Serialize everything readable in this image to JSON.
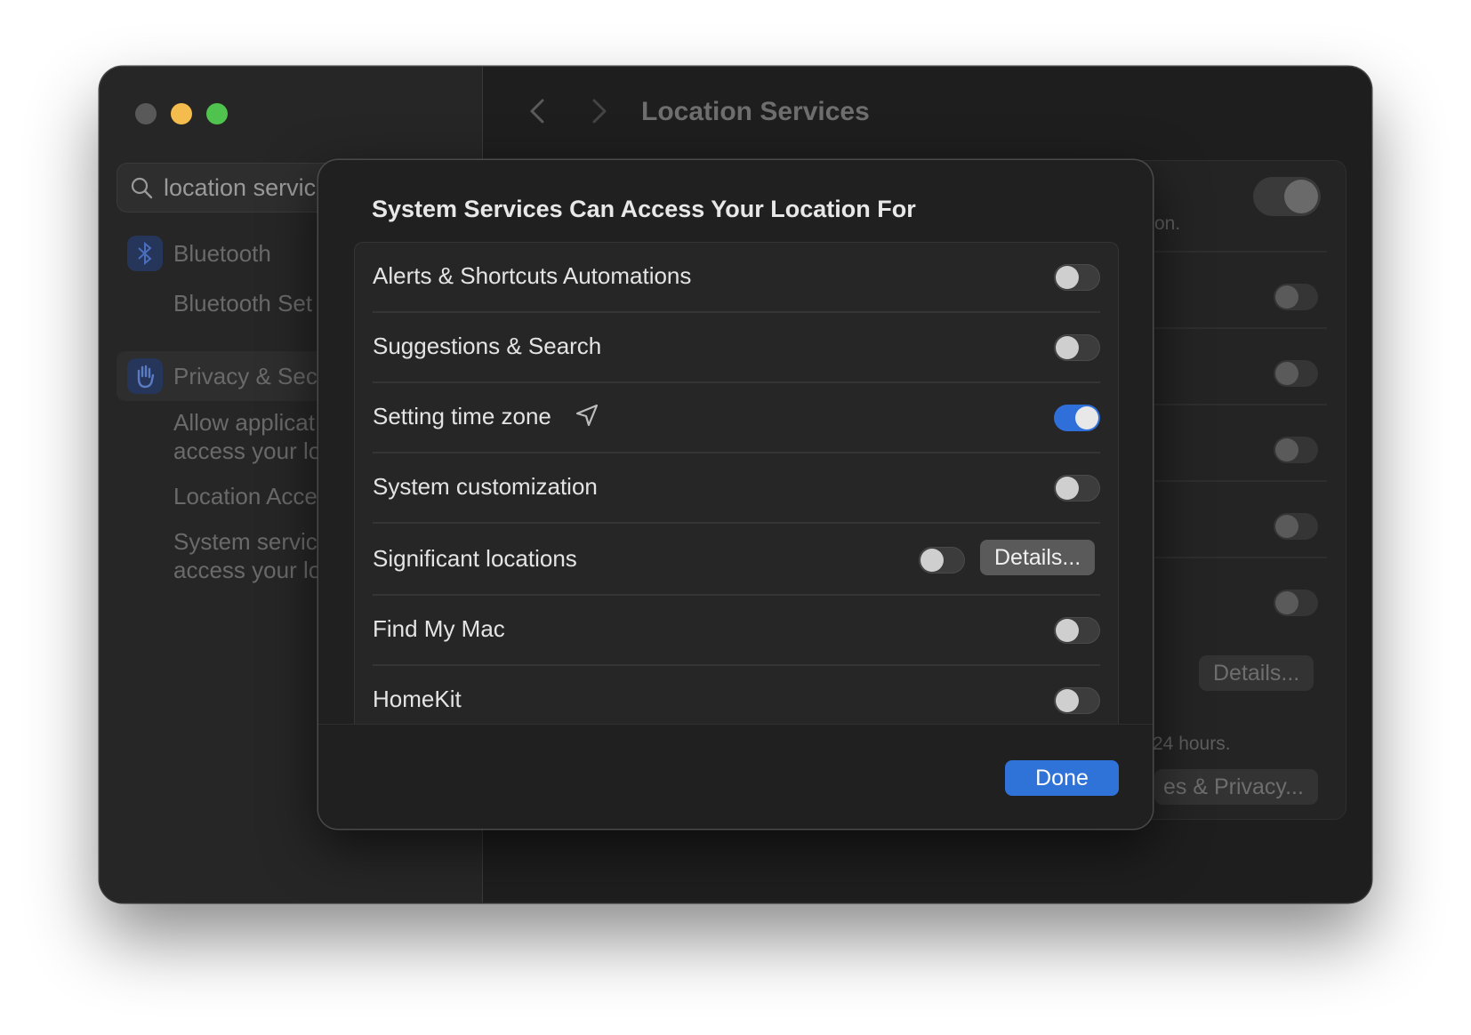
{
  "window": {
    "title": "Location Services",
    "search": {
      "value": "location servic"
    }
  },
  "sidebar": {
    "items": [
      {
        "label": "Bluetooth",
        "icon": "bluetooth-icon"
      },
      {
        "label": "Bluetooth Set"
      },
      {
        "label": "Privacy & Sec",
        "icon": "hand-icon"
      },
      {
        "label_line1": "Allow applicat",
        "label_line2": "access your lo"
      },
      {
        "label": "Location Acce"
      },
      {
        "label_line1": "System servic",
        "label_line2": "access your lo"
      }
    ]
  },
  "background": {
    "text_on": "on.",
    "text_hours": "24 hours.",
    "details_label": "Details...",
    "privacy_label": "es & Privacy..."
  },
  "sheet": {
    "title": "System Services Can Access Your Location For",
    "rows": [
      {
        "label": "Alerts & Shortcuts Automations",
        "enabled": false
      },
      {
        "label": "Suggestions & Search",
        "enabled": false
      },
      {
        "label": "Setting time zone",
        "enabled": true,
        "indicator_icon": "location-arrow-icon"
      },
      {
        "label": "System customization",
        "enabled": false
      },
      {
        "label": "Significant locations",
        "enabled": false,
        "button": "Details..."
      },
      {
        "label": "Find My Mac",
        "enabled": false
      },
      {
        "label": "HomeKit",
        "enabled": false
      }
    ],
    "done_label": "Done"
  },
  "colors": {
    "accent": "#2f72d8",
    "toggle_on": "#2e6fd9",
    "close": "#595959",
    "minimize": "#f4bc4c",
    "maximize": "#4fc34e"
  }
}
